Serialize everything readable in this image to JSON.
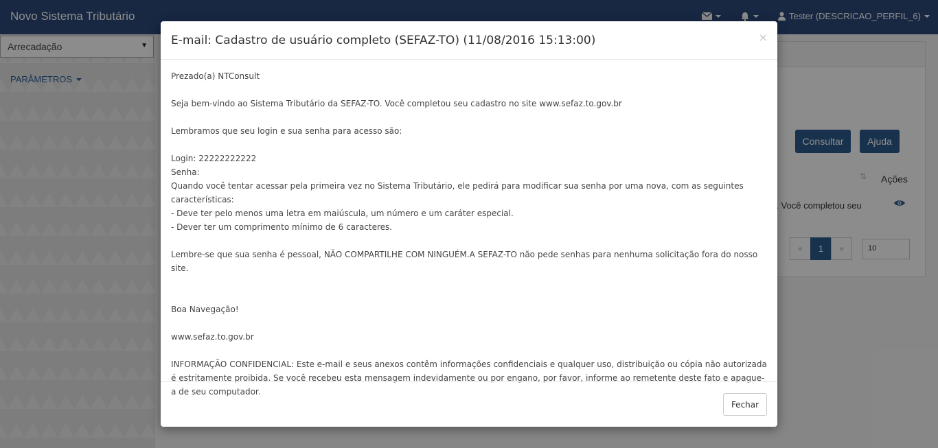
{
  "navbar": {
    "brand": "Novo Sistema Tributário",
    "user_label": "Tester (DESCRICAO_PERFIL_6)"
  },
  "sidebar": {
    "module_select": "Arrecadação",
    "menu_params": "PARÂMETROS"
  },
  "main": {
    "consultar_label": "Consultar",
    "ajuda_label": "Ajuda",
    "col_acoes": "Ações",
    "row_snippet": "). Você completou seu",
    "pager": {
      "prev": "«",
      "current": "1",
      "next": "»"
    },
    "page_size": "10"
  },
  "modal": {
    "title": "E-mail: Cadastro de usuário completo (SEFAZ-TO) (11/08/2016 15:13:00)",
    "close_symbol": "×",
    "body_lines": [
      "Prezado(a) NTConsult",
      "",
      "Seja bem-vindo ao Sistema Tributário da SEFAZ-TO. Você completou seu cadastro no site www.sefaz.to.gov.br",
      "",
      "Lembramos que seu login e sua senha para acesso são:",
      "",
      "Login: 22222222222",
      "Senha:",
      "Quando você tentar acessar pela primeira vez no Sistema Tributário, ele pedirá para modificar sua senha por uma nova, com as seguintes características:",
      "- Deve ter pelo menos uma letra em maiúscula, um número e um caráter especial.",
      "- Dever ter um comprimento mínimo de 6 caracteres.",
      "",
      "Lembre-se que sua senha é pessoal, NÃO COMPARTILHE COM NINGUÉM.A SEFAZ-TO não pede senhas para nenhuma solicitação fora do nosso site.",
      "",
      "",
      "Boa Navegação!",
      "",
      "www.sefaz.to.gov.br",
      "",
      "INFORMAÇÃO CONFIDENCIAL: Este e-mail e seus anexos contêm informações confidenciais e qualquer uso, distribuição ou cópia não autorizada é estritamente proibida. Se você recebeu esta mensagem indevidamente ou por engano, por favor, informe ao remetente deste fato e apague-a de seu computador."
    ],
    "close_button": "Fechar"
  }
}
